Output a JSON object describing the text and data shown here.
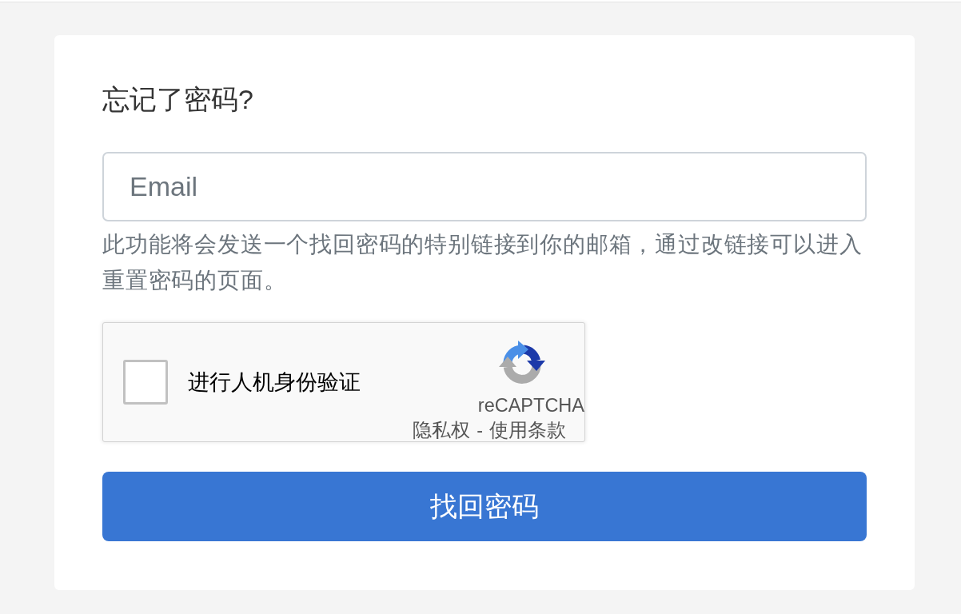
{
  "title": "忘记了密码?",
  "email_field": {
    "placeholder": "Email"
  },
  "help_text": "此功能将会发送一个找回密码的特别链接到你的邮箱，通过改链接可以进入重置密码的页面。",
  "recaptcha": {
    "checked": false,
    "label": "进行人机身份验证",
    "brand": "reCAPTCHA",
    "links": [
      {
        "label": "隐私权"
      },
      {
        "label": "使用条款"
      }
    ],
    "separator": "-"
  },
  "submit_button": "找回密码"
}
